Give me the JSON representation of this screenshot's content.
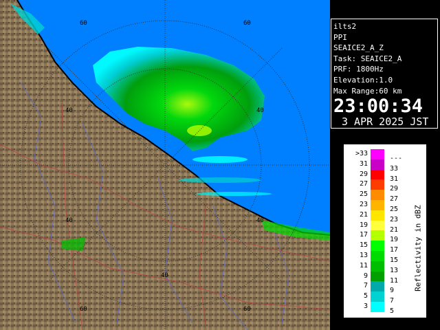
{
  "info": {
    "radar": "ilts2",
    "mode": "PPI",
    "product": "SEAICE2_A_Z",
    "task": "Task: SEAICE2_A",
    "prf": "PRF: 1800Hz",
    "elevation": "Elevation:1.0",
    "max_range": "Max Range:60 km",
    "time": "23:00:34",
    "date": "3 APR 2025 JST"
  },
  "legend": {
    "title": "Reflectivity in dBZ",
    "rows": [
      {
        "left": ">33",
        "right": "---",
        "color": "#ff00ff"
      },
      {
        "left": "31",
        "right": "33",
        "color": "#c800c8"
      },
      {
        "left": "29",
        "right": "31",
        "color": "#ff0000"
      },
      {
        "left": "27",
        "right": "29",
        "color": "#ff3c00"
      },
      {
        "left": "25",
        "right": "27",
        "color": "#ff8c00"
      },
      {
        "left": "23",
        "right": "25",
        "color": "#ffb400"
      },
      {
        "left": "21",
        "right": "23",
        "color": "#ffe600"
      },
      {
        "left": "19",
        "right": "21",
        "color": "#ffff3c"
      },
      {
        "left": "17",
        "right": "19",
        "color": "#b4ff00"
      },
      {
        "left": "15",
        "right": "17",
        "color": "#00ff00"
      },
      {
        "left": "13",
        "right": "15",
        "color": "#00dc00"
      },
      {
        "left": "11",
        "right": "13",
        "color": "#00be00"
      },
      {
        "left": "9",
        "right": "11",
        "color": "#00a000"
      },
      {
        "left": "7",
        "right": "9",
        "color": "#00aaaa"
      },
      {
        "left": "5",
        "right": "7",
        "color": "#00d2d2"
      },
      {
        "left": "3",
        "right": "5",
        "color": "#00ffff"
      }
    ]
  },
  "range_labels": [
    "60",
    "60",
    "40",
    "40",
    "40",
    "40",
    "60",
    "60"
  ],
  "colors": {
    "sea": "#0080ff",
    "land": "#8a7556",
    "coast": "#000000",
    "rings": "#303030"
  }
}
